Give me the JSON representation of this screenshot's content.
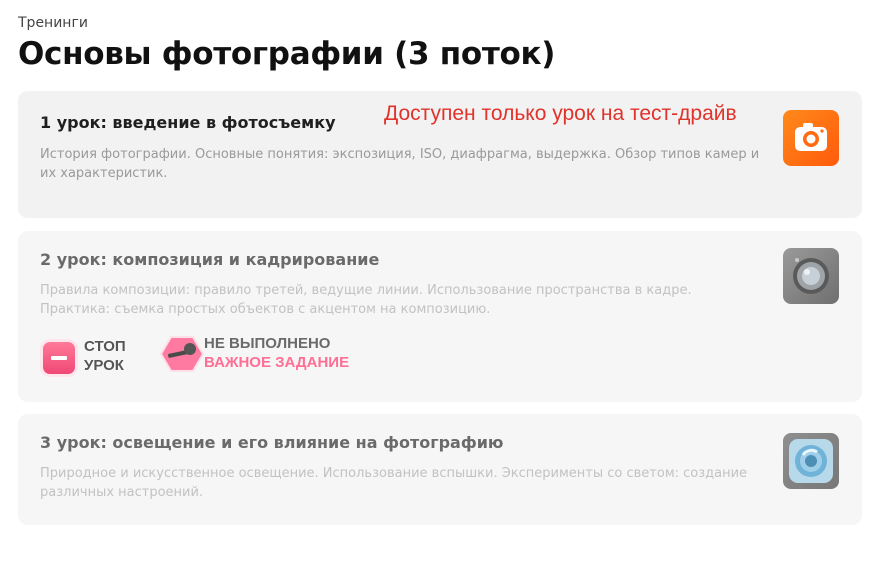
{
  "breadcrumb": "Тренинги",
  "page_title": "Основы фотографии (3 поток)",
  "lessons": [
    {
      "title": "1 урок: введение в фотосъемку",
      "description": "История фотографии. Основные понятия: экспозиция, ISO, диафрагма, выдержка. Обзор типов камер и их характеристик.",
      "icon": "camera-app-icon",
      "note": "Доступен только урок на тест-драйв"
    },
    {
      "title": "2 урок: композиция и кадрирование",
      "description": "Правила композиции: правило третей, ведущие линии. Использование пространства в кадре. Практика: съемка простых объектов с акцентом на композицию.",
      "icon": "camera-lens-icon",
      "badges": {
        "stop": {
          "line1": "СТОП",
          "line2": "УРОК"
        },
        "task": {
          "line1": "НЕ ВЫПОЛНЕНО",
          "line2": "ВАЖНОЕ ЗАДАНИЕ"
        }
      }
    },
    {
      "title": "3 урок: освещение и его влияние на фотографию",
      "description": "Природное и искусственное освещение. Использование вспышки. Эксперименты со светом: создание различных настроений.",
      "icon": "lens-blue-icon"
    }
  ],
  "colors": {
    "note": "#e0332b",
    "stop_badge": "#f04876",
    "task_badge": "#ff6f95",
    "camera_orange": "#ff6a12"
  }
}
